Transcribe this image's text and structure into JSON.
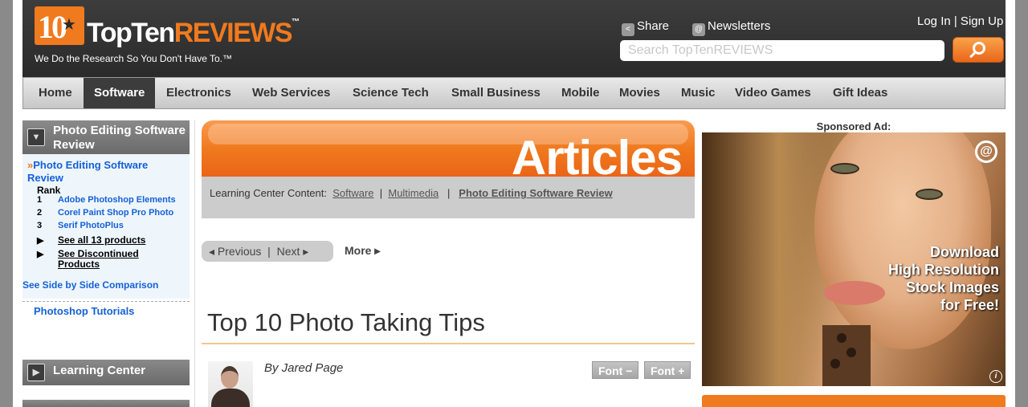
{
  "header": {
    "logo_number": "10",
    "logo_top": "TopTen",
    "logo_reviews": "REVIEWS",
    "logo_tm": "™",
    "tagline": "We Do the Research So You Don't Have To.™",
    "share_label": "Share",
    "newsletters_label": "Newsletters",
    "login_label": "Log In | Sign Up",
    "search_placeholder": "Search TopTenREVIEWS"
  },
  "nav": {
    "items": [
      {
        "label": "Home"
      },
      {
        "label": "Software",
        "active": true
      },
      {
        "label": "Electronics"
      },
      {
        "label": "Web Services"
      },
      {
        "label": "Science Tech"
      },
      {
        "label": "Small Business"
      },
      {
        "label": "Mobile"
      },
      {
        "label": "Movies"
      },
      {
        "label": "Music"
      },
      {
        "label": "Video Games"
      },
      {
        "label": "Gift Ideas"
      }
    ]
  },
  "sidebar": {
    "section_title": "Photo Editing Software Review",
    "current_link": "Photo Editing Software Review",
    "rank_label": "Rank",
    "products": [
      {
        "rank": "1",
        "name": "Adobe Photoshop Elements"
      },
      {
        "rank": "2",
        "name": "Corel Paint Shop Pro Photo"
      },
      {
        "rank": "3",
        "name": "Serif PhotoPlus"
      }
    ],
    "see_all": "See all 13 products",
    "see_discontinued": "See Discontinued Products",
    "side_by_side": "See Side by Side Comparison",
    "tutorials": "Photoshop Tutorials",
    "learning_center": "Learning Center"
  },
  "main": {
    "banner_title": "Articles",
    "crumb_prefix": "Learning Center Content:",
    "crumb_software": "Software",
    "crumb_multimedia": "Multimedia",
    "crumb_current": "Photo Editing Software Review",
    "previous_label": "◂ Previous",
    "next_label": "Next ▸",
    "more_label": "More ▸",
    "article_title": "Top 10 Photo Taking Tips",
    "byline": "By Jared Page",
    "font_minus": "Font −",
    "font_plus": "Font +"
  },
  "ad": {
    "label": "Sponsored Ad:",
    "text_line1": "Download",
    "text_line2": "High Resolution",
    "text_line3": "Stock Images",
    "text_line4": "for Free!"
  },
  "colors": {
    "brand_orange": "#f07a1e",
    "header_dark": "#2f2f2f",
    "link_blue": "#1560d8"
  }
}
